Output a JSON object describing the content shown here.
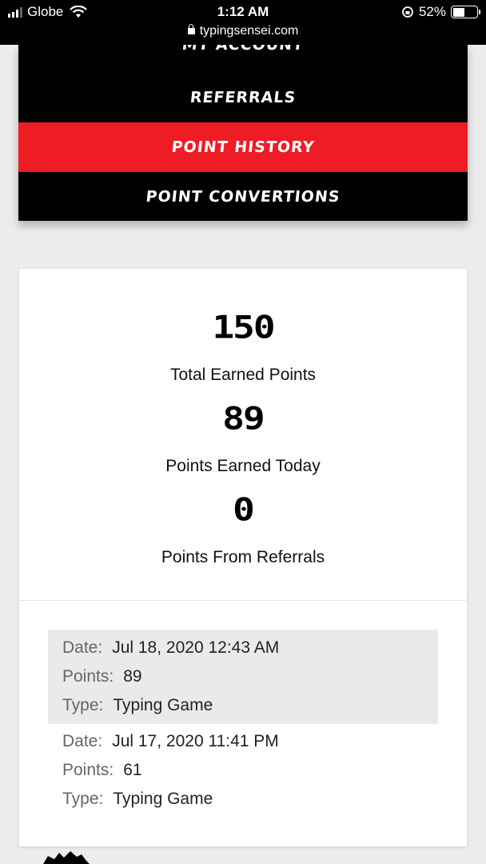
{
  "status_bar": {
    "carrier": "Globe",
    "time": "1:12 AM",
    "battery": "52%",
    "url": "typingsensei.com"
  },
  "menu": {
    "items": [
      {
        "label": "My Account"
      },
      {
        "label": "Referrals"
      },
      {
        "label": "Point History",
        "active": true
      },
      {
        "label": "Point Convertions"
      }
    ]
  },
  "stats": {
    "total_value": "150",
    "total_label": "Total Earned Points",
    "today_value": "89",
    "today_label": "Points Earned Today",
    "referral_value": "0",
    "referral_label": "Points From Referrals"
  },
  "history_labels": {
    "date": "Date:",
    "points": "Points:",
    "type": "Type:"
  },
  "history": [
    {
      "date": "Jul 18, 2020 12:43 AM",
      "points": "89",
      "type": "Typing Game"
    },
    {
      "date": "Jul 17, 2020 11:41 PM",
      "points": "61",
      "type": "Typing Game"
    }
  ],
  "colors": {
    "accent": "#ee1c25",
    "menu_bg": "#000000",
    "page_bg": "#ececec"
  }
}
